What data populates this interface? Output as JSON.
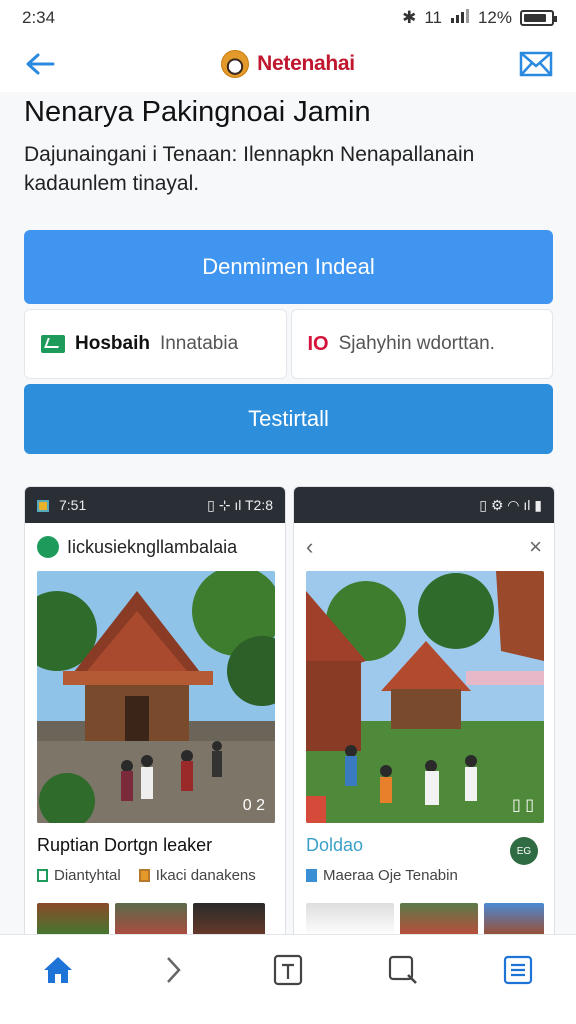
{
  "status_bar": {
    "time": "2:34",
    "signal_text": "11",
    "battery": "12%"
  },
  "app": {
    "name": "Netenahai"
  },
  "header": {
    "title": "Nenarya Pakingnoai Jamin",
    "subtitle": "Dajunaingani i Tenaan: Ilennapkn Nenapallanain kadaunlem tinayal."
  },
  "actions": {
    "primary_label": "Denmimen Indeal",
    "chip_left_bold": "Hosbaih",
    "chip_left_text": "Innatabia",
    "chip_right_icon": "IO",
    "chip_right_text": "Sjahyhin wdorttan.",
    "secondary_label": "Testirtall"
  },
  "cards": [
    {
      "status_time": "7:51",
      "status_right": "T2:8",
      "head_title": "Iickusiekngllambalaia",
      "photo_count": "0 2",
      "title": "Ruptian Dortgn leaker",
      "meta_left": "Diantyhtal",
      "meta_right": "Ikaci danakens"
    },
    {
      "title": "Doldao",
      "meta_left": "Maeraa Oje Tenabin",
      "avatar_text": "EG"
    }
  ],
  "icons": {
    "back": "arrow-left-icon",
    "mail": "mail-icon",
    "home": "home-icon",
    "forward": "chevron-right-icon",
    "add": "add-square-icon",
    "search": "search-icon",
    "menu": "list-icon"
  },
  "colors": {
    "primary_button": "#3f95ef",
    "secondary_button": "#2d8fdc",
    "brand": "#c0172e",
    "nav_accent": "#1e73d6"
  }
}
